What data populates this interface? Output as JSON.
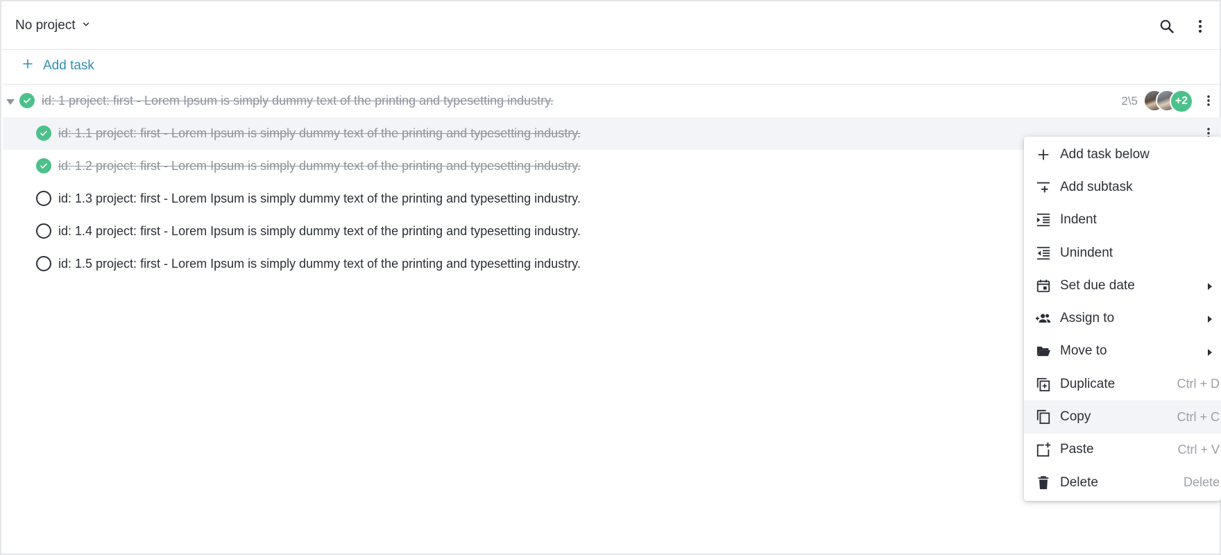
{
  "header": {
    "project_label": "No project",
    "search_icon": "search-icon",
    "more_icon": "more-vert-icon"
  },
  "add_task": {
    "label": "Add task",
    "icon": "plus-icon"
  },
  "tasks": [
    {
      "id_text": "id: 1 project: first - Lorem Ipsum is simply dummy text of the printing and typesetting industry.",
      "done": true,
      "level": 0,
      "progress": "2\\5",
      "assignees_more": "+2"
    },
    {
      "id_text": "id: 1.1 project: first - Lorem Ipsum is simply dummy text of the printing and typesetting industry.",
      "done": true,
      "level": 1
    },
    {
      "id_text": "id: 1.2 project: first - Lorem Ipsum is simply dummy text of the printing and typesetting industry.",
      "done": true,
      "level": 1
    },
    {
      "id_text": "id: 1.3 project: first - Lorem Ipsum is simply dummy text of the printing and typesetting industry.",
      "done": false,
      "level": 1
    },
    {
      "id_text": "id: 1.4 project: first - Lorem Ipsum is simply dummy text of the printing and typesetting industry.",
      "done": false,
      "level": 1
    },
    {
      "id_text": "id: 1.5 project: first - Lorem Ipsum is simply dummy text of the printing and typesetting industry.",
      "done": false,
      "level": 1
    }
  ],
  "context_menu": {
    "items": [
      {
        "label": "Add task below",
        "icon": "plus-icon",
        "shortcut": ""
      },
      {
        "label": "Add subtask",
        "icon": "add-subtask-icon",
        "shortcut": ""
      },
      {
        "label": "Indent",
        "icon": "indent-icon",
        "shortcut": ""
      },
      {
        "label": "Unindent",
        "icon": "unindent-icon",
        "shortcut": ""
      },
      {
        "label": "Set due date",
        "icon": "calendar-icon",
        "shortcut": "",
        "submenu": true
      },
      {
        "label": "Assign to",
        "icon": "assign-people-icon",
        "shortcut": "",
        "submenu": true
      },
      {
        "label": "Move to",
        "icon": "folder-icon",
        "shortcut": "",
        "submenu": true
      },
      {
        "label": "Duplicate",
        "icon": "duplicate-icon",
        "shortcut": "Ctrl + D"
      },
      {
        "label": "Copy",
        "icon": "copy-icon",
        "shortcut": "Ctrl + C"
      },
      {
        "label": "Paste",
        "icon": "paste-icon",
        "shortcut": "Ctrl + V"
      },
      {
        "label": "Delete",
        "icon": "trash-icon",
        "shortcut": "Delete"
      }
    ]
  },
  "colors": {
    "accent": "#2e8fb8",
    "done_green": "#4cc18b",
    "muted_text": "#8e949c",
    "highlight_row": "#f2f4f7"
  }
}
